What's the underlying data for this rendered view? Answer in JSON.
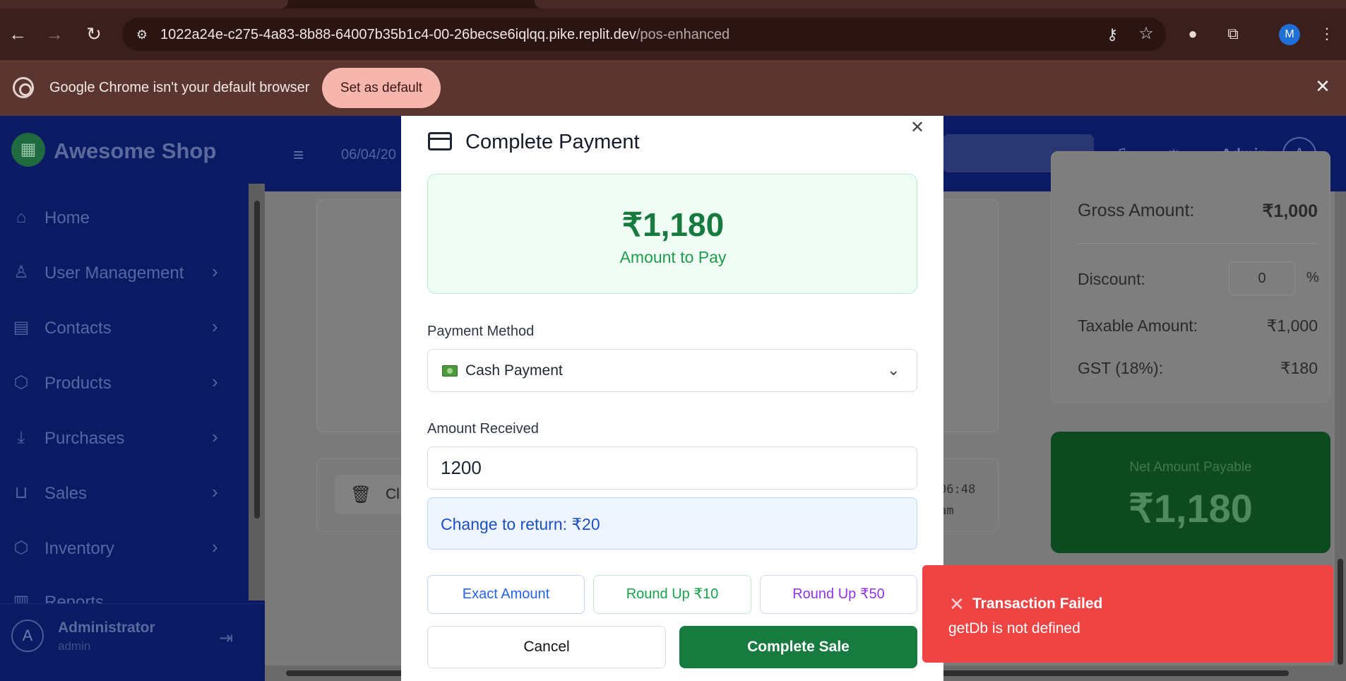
{
  "browser": {
    "url_host": "1022a24e-c275-4a83-8b88-64007b35b1c4-00-26becse6iqlqq.pike.replit.dev",
    "url_path": "/pos-enhanced",
    "profile_initial": "M",
    "infobar_message": "Google Chrome isn't your default browser",
    "set_default_label": "Set as default"
  },
  "app": {
    "brand": "Awesome Shop",
    "date_text": "06/04/20",
    "admin_label": "Admin",
    "admin_initial": "A",
    "sidebar": [
      {
        "label": "Home",
        "icon": "home-icon",
        "has_children": false
      },
      {
        "label": "User Management",
        "icon": "user-icon",
        "has_children": true
      },
      {
        "label": "Contacts",
        "icon": "contacts-icon",
        "has_children": true
      },
      {
        "label": "Products",
        "icon": "box-icon",
        "has_children": true
      },
      {
        "label": "Purchases",
        "icon": "download-icon",
        "has_children": true
      },
      {
        "label": "Sales",
        "icon": "bag-icon",
        "has_children": true
      },
      {
        "label": "Inventory",
        "icon": "box-icon",
        "has_children": true
      },
      {
        "label": "Reports",
        "icon": "chart-icon",
        "has_children": false
      }
    ],
    "footer_user": {
      "initial": "A",
      "name": "Administrator",
      "role": "admin"
    },
    "clear_label": "Cl",
    "time_line1": "06:48",
    "time_line2": "am"
  },
  "summary": {
    "gross_label": "Gross Amount:",
    "gross_value": "₹1,000",
    "discount_label": "Discount:",
    "discount_value": "0",
    "discount_unit": "%",
    "taxable_label": "Taxable Amount:",
    "taxable_value": "₹1,000",
    "gst_label": "GST (18%):",
    "gst_value": "₹180",
    "net_label": "Net Amount Payable",
    "net_value": "₹1,180"
  },
  "modal": {
    "title": "Complete Payment",
    "amount": "₹1,180",
    "amount_label": "Amount to Pay",
    "payment_method_label": "Payment Method",
    "payment_method_value": "Cash Payment",
    "amount_received_label": "Amount Received",
    "amount_received_value": "1200",
    "change_text": "Change to return: ₹20",
    "quick": {
      "exact": "Exact Amount",
      "up10": "Round Up ₹10",
      "up50": "Round Up ₹50"
    },
    "cancel_label": "Cancel",
    "complete_label": "Complete Sale"
  },
  "toast": {
    "title": "Transaction Failed",
    "message": "getDb is not defined"
  },
  "colors": {
    "sidebar_bg": "#0a1a63",
    "success_green": "#177a3f",
    "error_red": "#ef4444",
    "info_blue": "#2563eb",
    "purple": "#9333ea"
  }
}
